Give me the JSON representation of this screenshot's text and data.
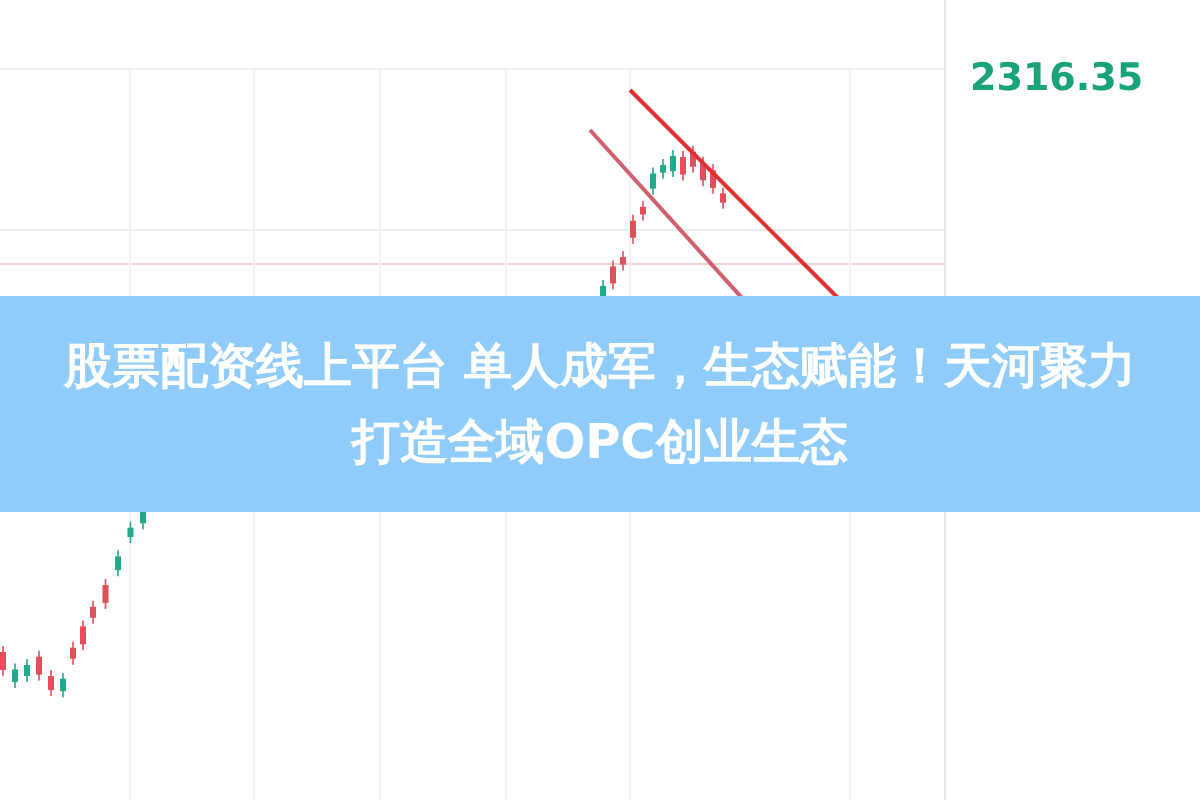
{
  "headline": {
    "text": "股票配资线上平台 单人成军，生态赋能！天河聚力打造全域OPC创业生态"
  },
  "quote_panel": {
    "price": "2316.35"
  }
}
